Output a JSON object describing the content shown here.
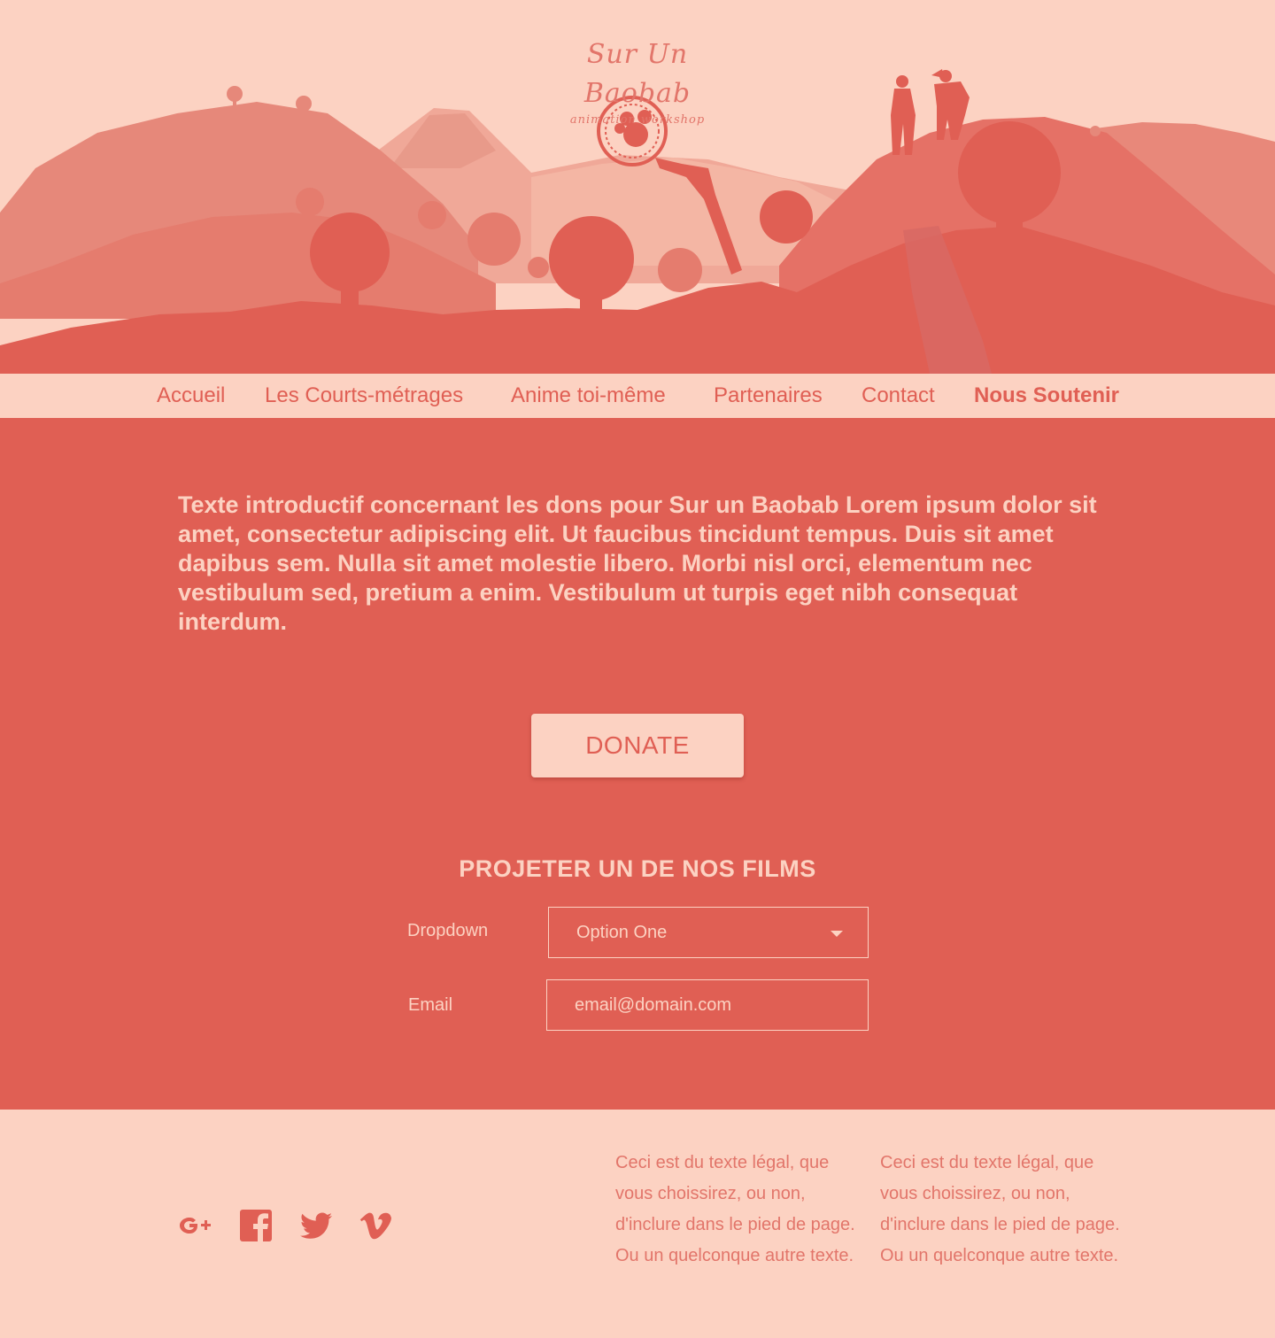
{
  "brand": {
    "title": "Sur Un Baobab",
    "subtitle": "animation workshop"
  },
  "colors": {
    "primary": "#e05f54",
    "light": "#fcd2c2"
  },
  "nav": {
    "items": [
      {
        "label": "Accueil"
      },
      {
        "label": "Les Courts-métrages"
      },
      {
        "label": "Anime toi-même"
      },
      {
        "label": "Partenaires"
      },
      {
        "label": "Contact"
      },
      {
        "label": "Nous Soutenir",
        "active": true
      }
    ]
  },
  "main": {
    "intro": "Texte introductif concernant les dons pour Sur un Baobab Lorem ipsum dolor sit amet, consectetur adipiscing elit. Ut faucibus tincidunt tempus. Duis sit amet dapibus sem. Nulla sit amet molestie libero. Morbi nisl orci, elementum nec vestibulum sed, pretium a enim. Vestibulum ut turpis eget nibh consequat interdum.",
    "donate_label": "DONATE",
    "form": {
      "title": "PROJETER UN DE NOS FILMS",
      "dropdown_label": "Dropdown",
      "dropdown_value": "Option One",
      "email_label": "Email",
      "email_placeholder": "email@domain.com"
    }
  },
  "footer": {
    "social_icons": [
      "google-plus-icon",
      "facebook-icon",
      "twitter-icon",
      "vimeo-icon"
    ],
    "legal_1": "Ceci est du texte légal, que vous choissirez, ou non, d'inclure dans le pied de page. Ou un quelconque autre texte.",
    "legal_2": "Ceci est du texte légal, que vous choissirez, ou non, d'inclure dans le pied de page. Ou un quelconque autre texte."
  }
}
